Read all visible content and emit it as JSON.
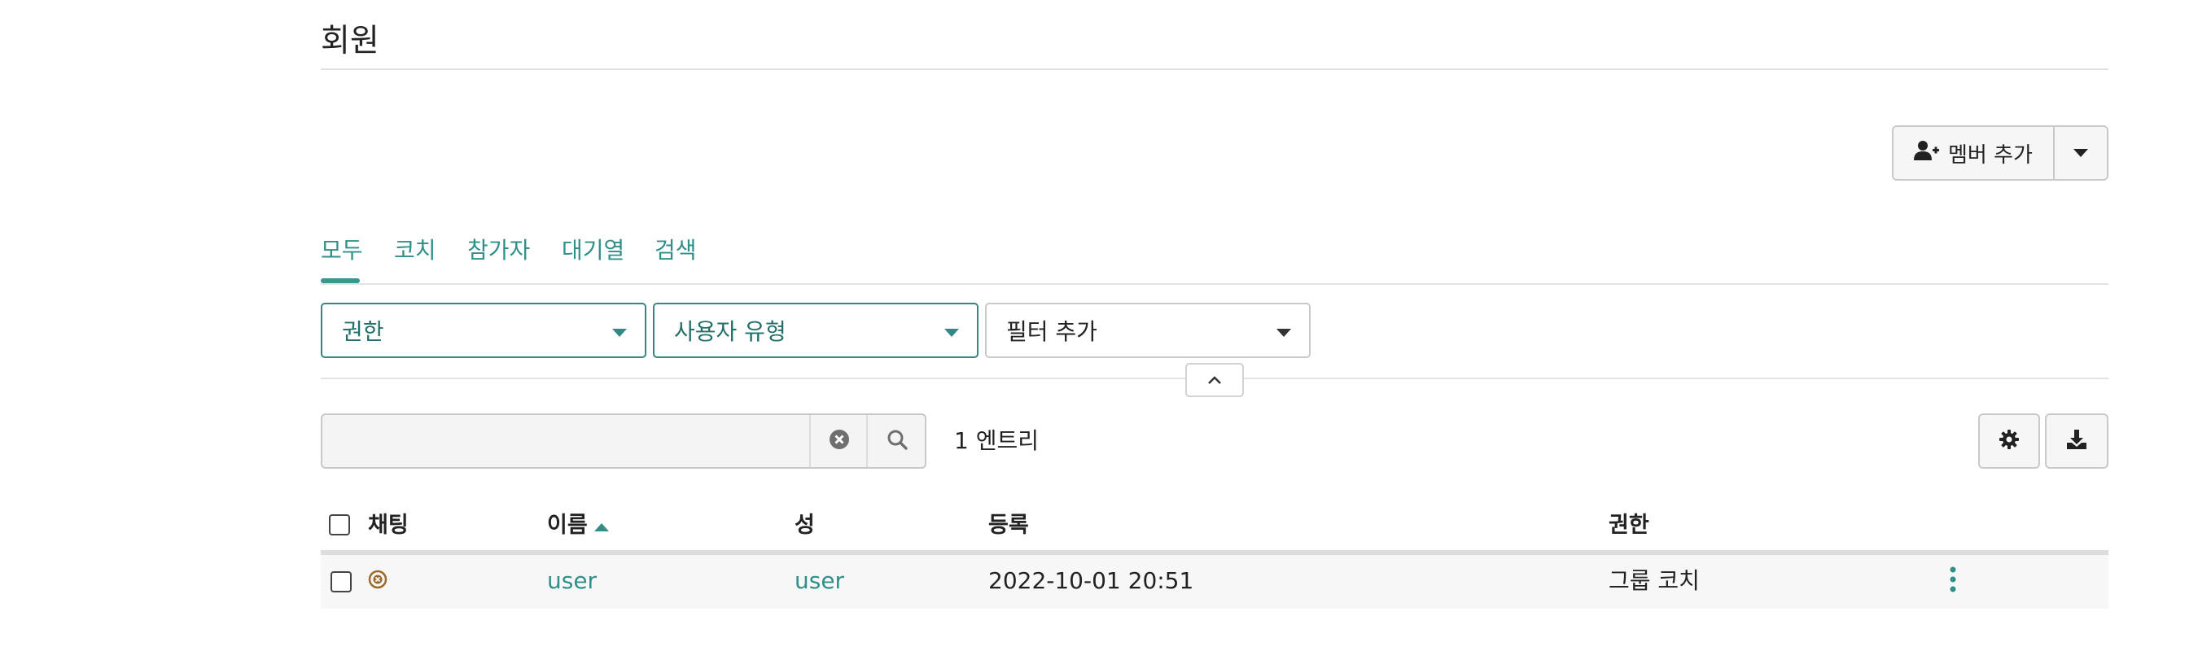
{
  "page": {
    "title": "회원"
  },
  "toolbar": {
    "add_member_label": "멤버 추가"
  },
  "tabs": [
    {
      "label": "모두",
      "active": true
    },
    {
      "label": "코치"
    },
    {
      "label": "참가자"
    },
    {
      "label": "대기열"
    },
    {
      "label": "검색"
    }
  ],
  "filters": [
    {
      "label": "권한",
      "active": true
    },
    {
      "label": "사용자 유형",
      "active": true
    },
    {
      "label": "필터 추가",
      "active": false
    }
  ],
  "search": {
    "value": "",
    "placeholder": ""
  },
  "results": {
    "count_label": "1 엔트리"
  },
  "table": {
    "columns": [
      "채팅",
      "이름",
      "성",
      "등록",
      "권한"
    ],
    "sort": {
      "column": "이름",
      "direction": "asc"
    },
    "rows": [
      {
        "chat_status": "offline",
        "first_name": "user",
        "last_name": "user",
        "registered": "2022-10-01 20:51",
        "role": "그룹 코치"
      }
    ]
  },
  "colors": {
    "accent": "#2f8f89",
    "chat_status_icon": "#9a6a2f"
  },
  "icons": [
    "add-user-icon",
    "caret-down-icon",
    "chevron-up-icon",
    "clear-icon",
    "search-icon",
    "gear-icon",
    "download-icon",
    "chat-status-icon",
    "more-vertical-icon",
    "sort-asc-icon"
  ]
}
